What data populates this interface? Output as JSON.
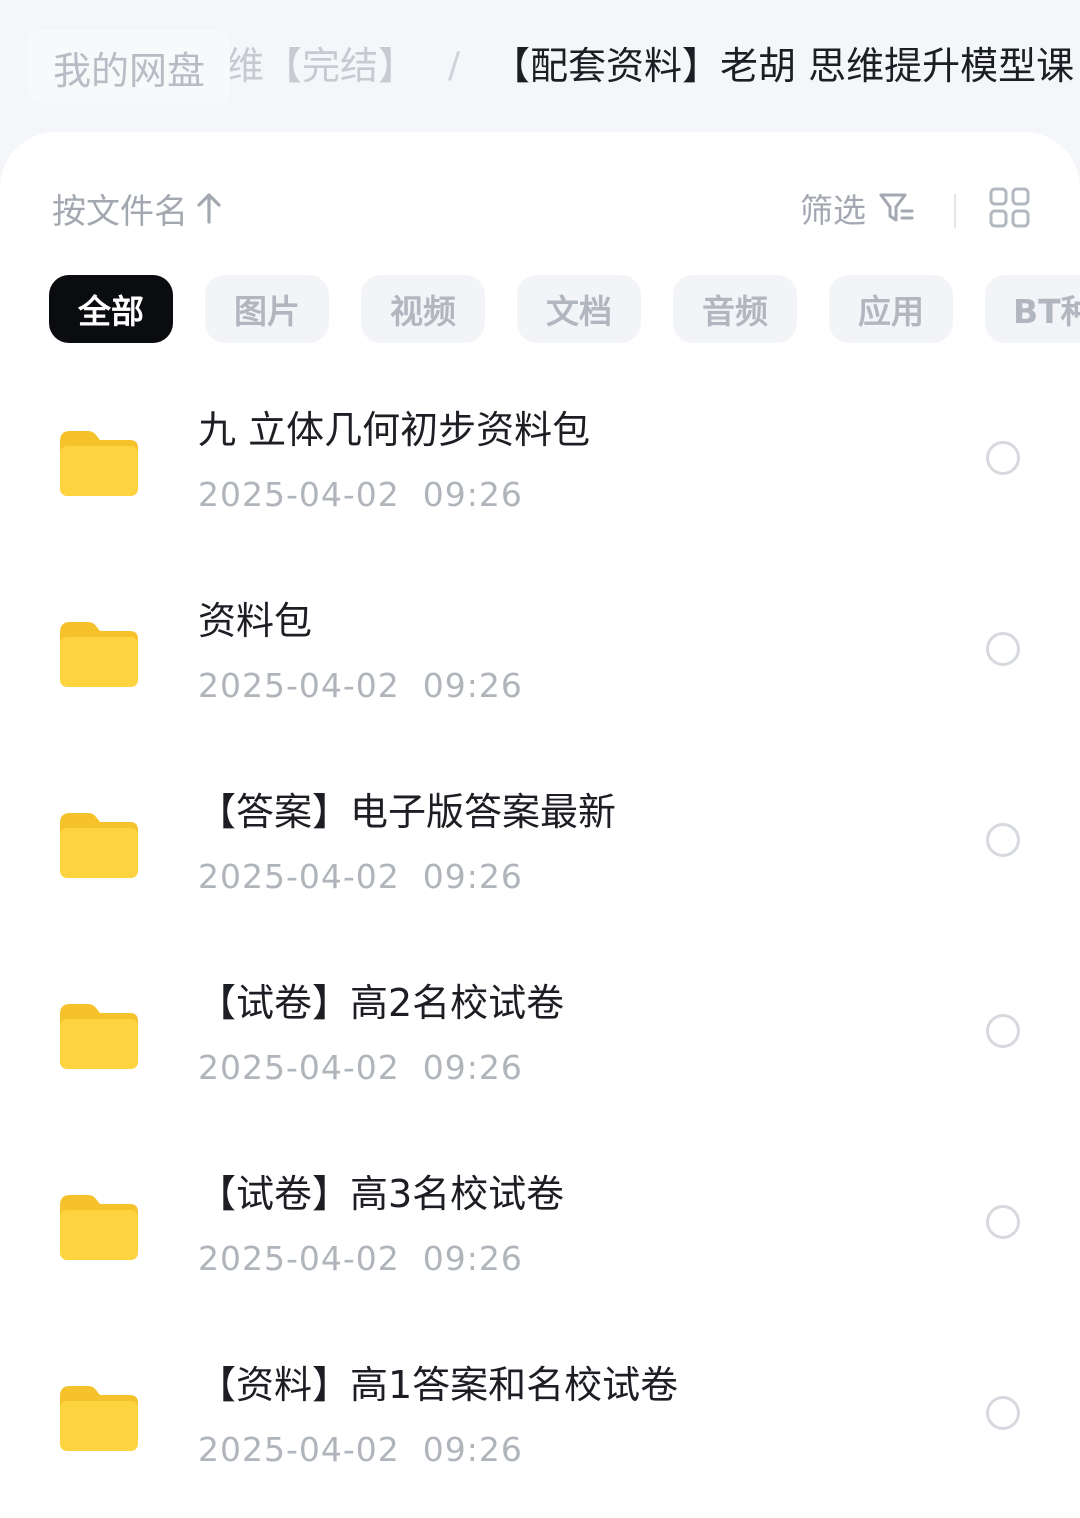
{
  "breadcrumb": {
    "root": "我的网盘",
    "parent": "维【完结】",
    "separator": "/",
    "current": "【配套资料】老胡 思维提升模型课"
  },
  "toolbar": {
    "sort_label": "按文件名",
    "sort_icon": "arrow-up-icon",
    "filter_label": "筛选",
    "filter_icon": "filter-icon",
    "view_icon": "grid-view-icon"
  },
  "chips": [
    {
      "label": "全部",
      "active": true
    },
    {
      "label": "图片",
      "active": false
    },
    {
      "label": "视频",
      "active": false
    },
    {
      "label": "文档",
      "active": false
    },
    {
      "label": "音频",
      "active": false
    },
    {
      "label": "应用",
      "active": false
    },
    {
      "label": "BT种",
      "active": false
    }
  ],
  "files": [
    {
      "name": "九 立体几何初步资料包",
      "date": "2025-04-02  09:26"
    },
    {
      "name": "资料包",
      "date": "2025-04-02  09:26"
    },
    {
      "name": "【答案】电子版答案最新",
      "date": "2025-04-02  09:26"
    },
    {
      "name": "【试卷】高2名校试卷",
      "date": "2025-04-02  09:26"
    },
    {
      "name": "【试卷】高3名校试卷",
      "date": "2025-04-02  09:26"
    },
    {
      "name": "【资料】高1答案和名校试卷",
      "date": "2025-04-02  09:26"
    }
  ],
  "colors": {
    "folder_body": "#fdd33f",
    "folder_tab": "#f6c22c",
    "active_chip": "#0b0c10",
    "text_primary": "#1c1e24",
    "text_secondary": "#b0b4bb"
  }
}
